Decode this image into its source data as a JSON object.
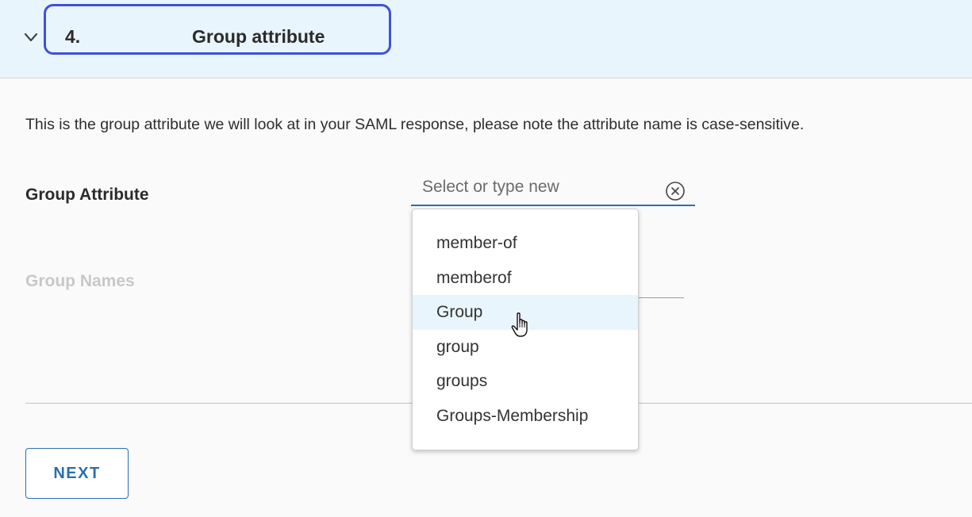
{
  "step": {
    "number": "4.",
    "title": "Group attribute"
  },
  "description": "This is the group attribute we will look at in your SAML response, please note the attribute name is case-sensitive.",
  "form": {
    "group_attribute_label": "Group Attribute",
    "group_attribute_placeholder": "Select or type new",
    "group_names_label": "Group Names"
  },
  "dropdown": {
    "options": [
      "member-of",
      "memberof",
      "Group",
      "group",
      "groups",
      "Groups-Membership"
    ],
    "hovered_index": 2
  },
  "buttons": {
    "next_label": "NEXT"
  },
  "icons": {
    "collapse": "chevron-down-icon",
    "clear": "clear-circle-x-icon",
    "pointer": "hand-pointer-cursor-icon"
  },
  "colors": {
    "header_bg": "#e8f5fd",
    "accent": "#2a6fb0",
    "highlight_box": "#3f51d6",
    "disabled_text": "#c8c8c8"
  }
}
